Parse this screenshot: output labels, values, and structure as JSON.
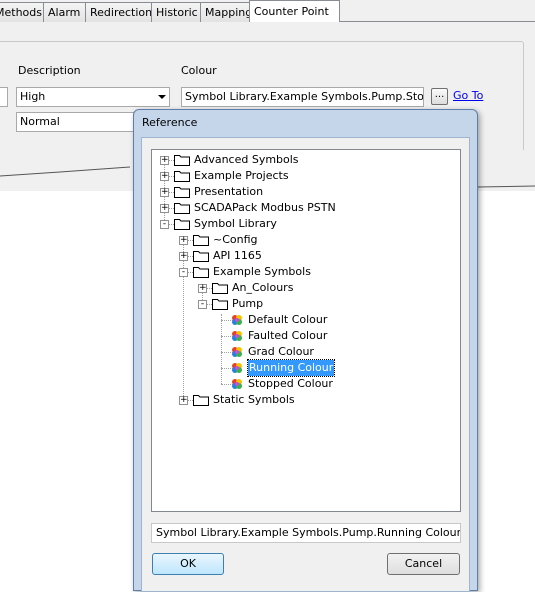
{
  "tabs": [
    "Methods",
    "Alarm",
    "Redirection",
    "Historic",
    "Mapping",
    "Counter Point"
  ],
  "form": {
    "description_label": "Description",
    "colour_label": "Colour",
    "row1_description": "High",
    "row1_colour": "Symbol Library.Example Symbols.Pump.Stopped Colour",
    "row1_ellipsis": "...",
    "row1_link": "Go To",
    "row2_description": "Normal"
  },
  "dialog": {
    "title": "Reference",
    "tree": [
      {
        "label": "Advanced Symbols",
        "icon": "folder-icon",
        "expander": "+"
      },
      {
        "label": "Example Projects",
        "icon": "folder-icon",
        "expander": "+"
      },
      {
        "label": "Presentation",
        "icon": "folder-icon",
        "expander": "+"
      },
      {
        "label": "SCADAPack Modbus PSTN",
        "icon": "folder-icon",
        "expander": "+"
      },
      {
        "label": "Symbol Library",
        "icon": "folder-icon",
        "expander": "-"
      },
      {
        "label": "~Config",
        "icon": "folder-icon",
        "expander": "+"
      },
      {
        "label": "API 1165",
        "icon": "folder-icon",
        "expander": "+"
      },
      {
        "label": "Example Symbols",
        "icon": "folder-icon",
        "expander": "-"
      },
      {
        "label": "An_Colours",
        "icon": "folder-icon",
        "expander": "+"
      },
      {
        "label": "Pump",
        "icon": "folder-icon",
        "expander": "-"
      },
      {
        "label": "Default Colour",
        "icon": "colour-icon",
        "expander": ""
      },
      {
        "label": "Faulted Colour",
        "icon": "colour-icon",
        "expander": ""
      },
      {
        "label": "Grad Colour",
        "icon": "colour-icon",
        "expander": ""
      },
      {
        "label": "Running Colour",
        "icon": "colour-icon",
        "expander": "",
        "selected": true
      },
      {
        "label": "Stopped Colour",
        "icon": "colour-icon",
        "expander": ""
      },
      {
        "label": "Static Symbols",
        "icon": "folder-icon",
        "expander": "+"
      }
    ],
    "path_value": "Symbol Library.Example Symbols.Pump.Running Colour",
    "ok_label": "OK",
    "cancel_label": "Cancel"
  }
}
